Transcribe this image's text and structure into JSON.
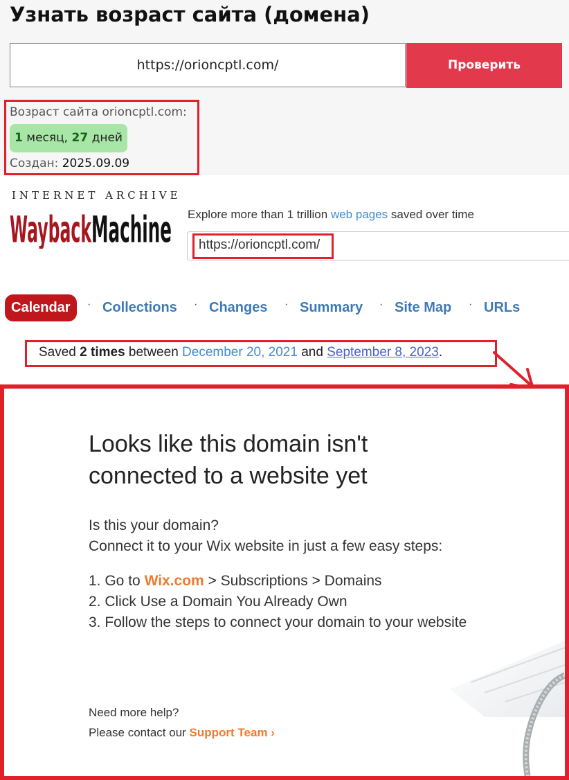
{
  "checker": {
    "title": "Узнать возраст сайта (домена)",
    "url_value": "https://orioncptl.com/",
    "check_label": "Проверить",
    "age_label": "Возраст сайта orioncptl.com:",
    "age_months": "1",
    "age_months_unit": "месяц,",
    "age_days": "27",
    "age_days_unit": "дней",
    "created_label": "Создан:",
    "created_value": "2025.09.09"
  },
  "wayback": {
    "ia_text": "INTERNET ARCHIVE",
    "logo_text": "WaybackMachine",
    "explore_prefix": "Explore more than 1 trillion",
    "explore_link": "web pages",
    "explore_suffix": "saved over time",
    "search_value": "https://orioncptl.com/"
  },
  "tabs": [
    {
      "label": "Calendar"
    },
    {
      "label": "Collections"
    },
    {
      "label": "Changes"
    },
    {
      "label": "Summary"
    },
    {
      "label": "Site Map"
    },
    {
      "label": "URLs"
    }
  ],
  "saved": {
    "prefix": "Saved",
    "count": "2 times",
    "between": "between",
    "first": "December 20, 2021",
    "and": "and",
    "last": "September 8, 2023",
    "end": "."
  },
  "snapshot": {
    "heading_line1": "Looks like this domain isn't",
    "heading_line2": "connected to a website yet",
    "question": "Is this your domain?",
    "connect": "Connect it to your Wix website in just a few easy steps:",
    "step1_prefix": "1. Go to",
    "step1_link": "Wix.com",
    "step1_suffix": "> Subscriptions > Domains",
    "step2": "2. Click Use a Domain You Already Own",
    "step3": "3. Follow the steps to connect your domain to your website",
    "help_question": "Need more help?",
    "help_prefix": "Please contact our",
    "help_link": "Support Team ›"
  },
  "colors": {
    "accent_red": "#e23a4c",
    "highlight_red": "#e0202b",
    "calendar_red": "#c0171c",
    "link_blue": "#428bca",
    "wix_orange": "#f07a2d",
    "age_green": "#a7e6a6"
  }
}
